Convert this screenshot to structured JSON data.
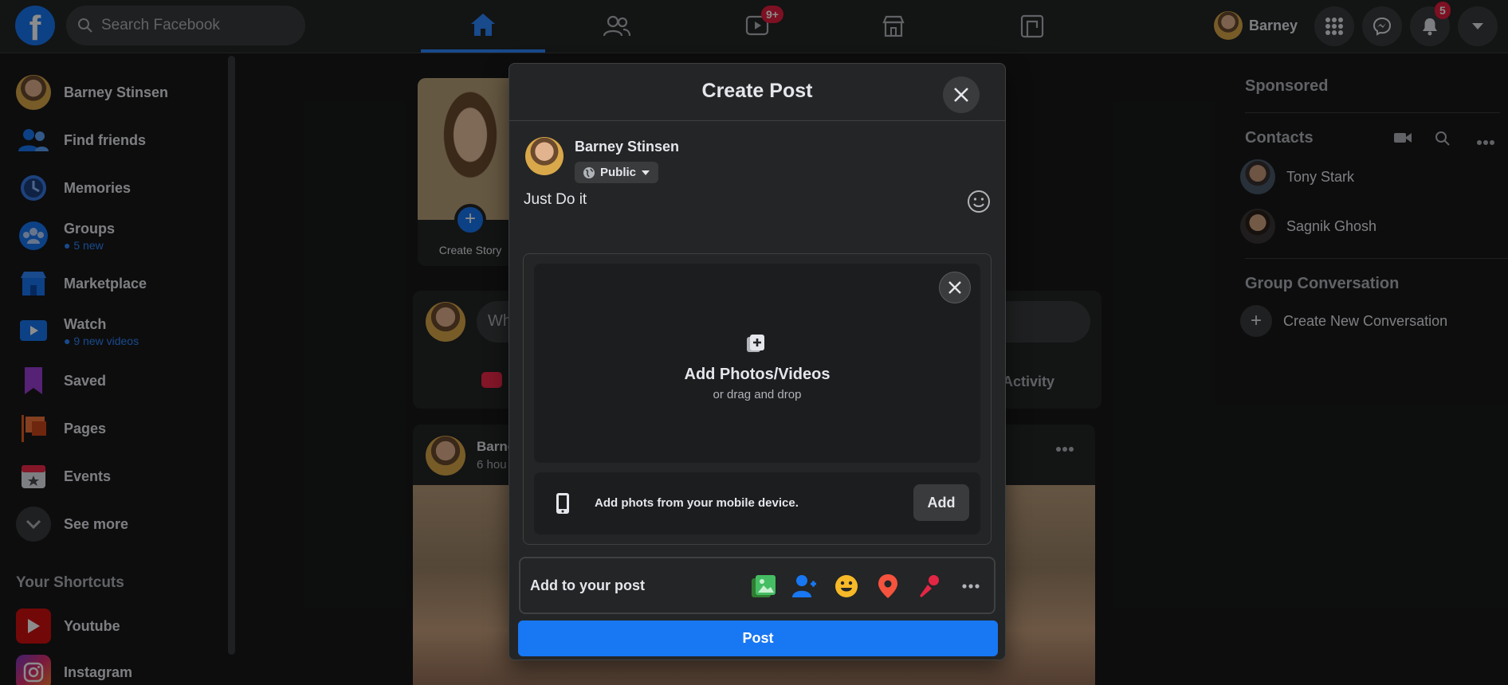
{
  "topbar": {
    "logo_letter": "f",
    "search_placeholder": "Search Facebook",
    "watch_badge": "9+",
    "profile_name": "Barney",
    "notifications_badge": "5"
  },
  "leftbar": {
    "profile_name": "Barney Stinsen",
    "items": [
      {
        "label": "Find friends"
      },
      {
        "label": "Memories"
      },
      {
        "label": "Groups",
        "sub": "5 new"
      },
      {
        "label": "Marketplace"
      },
      {
        "label": "Watch",
        "sub": "9 new videos"
      },
      {
        "label": "Saved"
      },
      {
        "label": "Pages"
      },
      {
        "label": "Events"
      },
      {
        "label": "See more"
      }
    ],
    "shortcuts_title": "Your Shortcuts",
    "shortcuts": [
      {
        "label": "Youtube"
      },
      {
        "label": "Instagram"
      }
    ]
  },
  "feed": {
    "create_story_label": "Create Story",
    "composer_placeholder_fragment": "Wh",
    "composer_activity_fragment": "Activity",
    "post_author_fragment": "Barne",
    "post_time_fragment": "6 hou"
  },
  "rightbar": {
    "sponsored": "Sponsored",
    "contacts_title": "Contacts",
    "contacts": [
      {
        "name": "Tony Stark"
      },
      {
        "name": "Sagnik Ghosh"
      }
    ],
    "group_title": "Group Conversation",
    "create_group": "Create New Conversation"
  },
  "modal": {
    "title": "Create Post",
    "author_name": "Barney Stinsen",
    "privacy": "Public",
    "post_text": "Just Do it",
    "dropzone_title": "Add Photos/Videos",
    "dropzone_sub": "or drag and drop",
    "mobile_text": "Add phots from your mobile device.",
    "mobile_add_label": "Add",
    "add_to_post_label": "Add to your post",
    "post_button_label": "Post"
  },
  "colors": {
    "accent": "#1877f2",
    "background": "#18191a",
    "surface": "#242526",
    "badge": "#e41e3f"
  }
}
